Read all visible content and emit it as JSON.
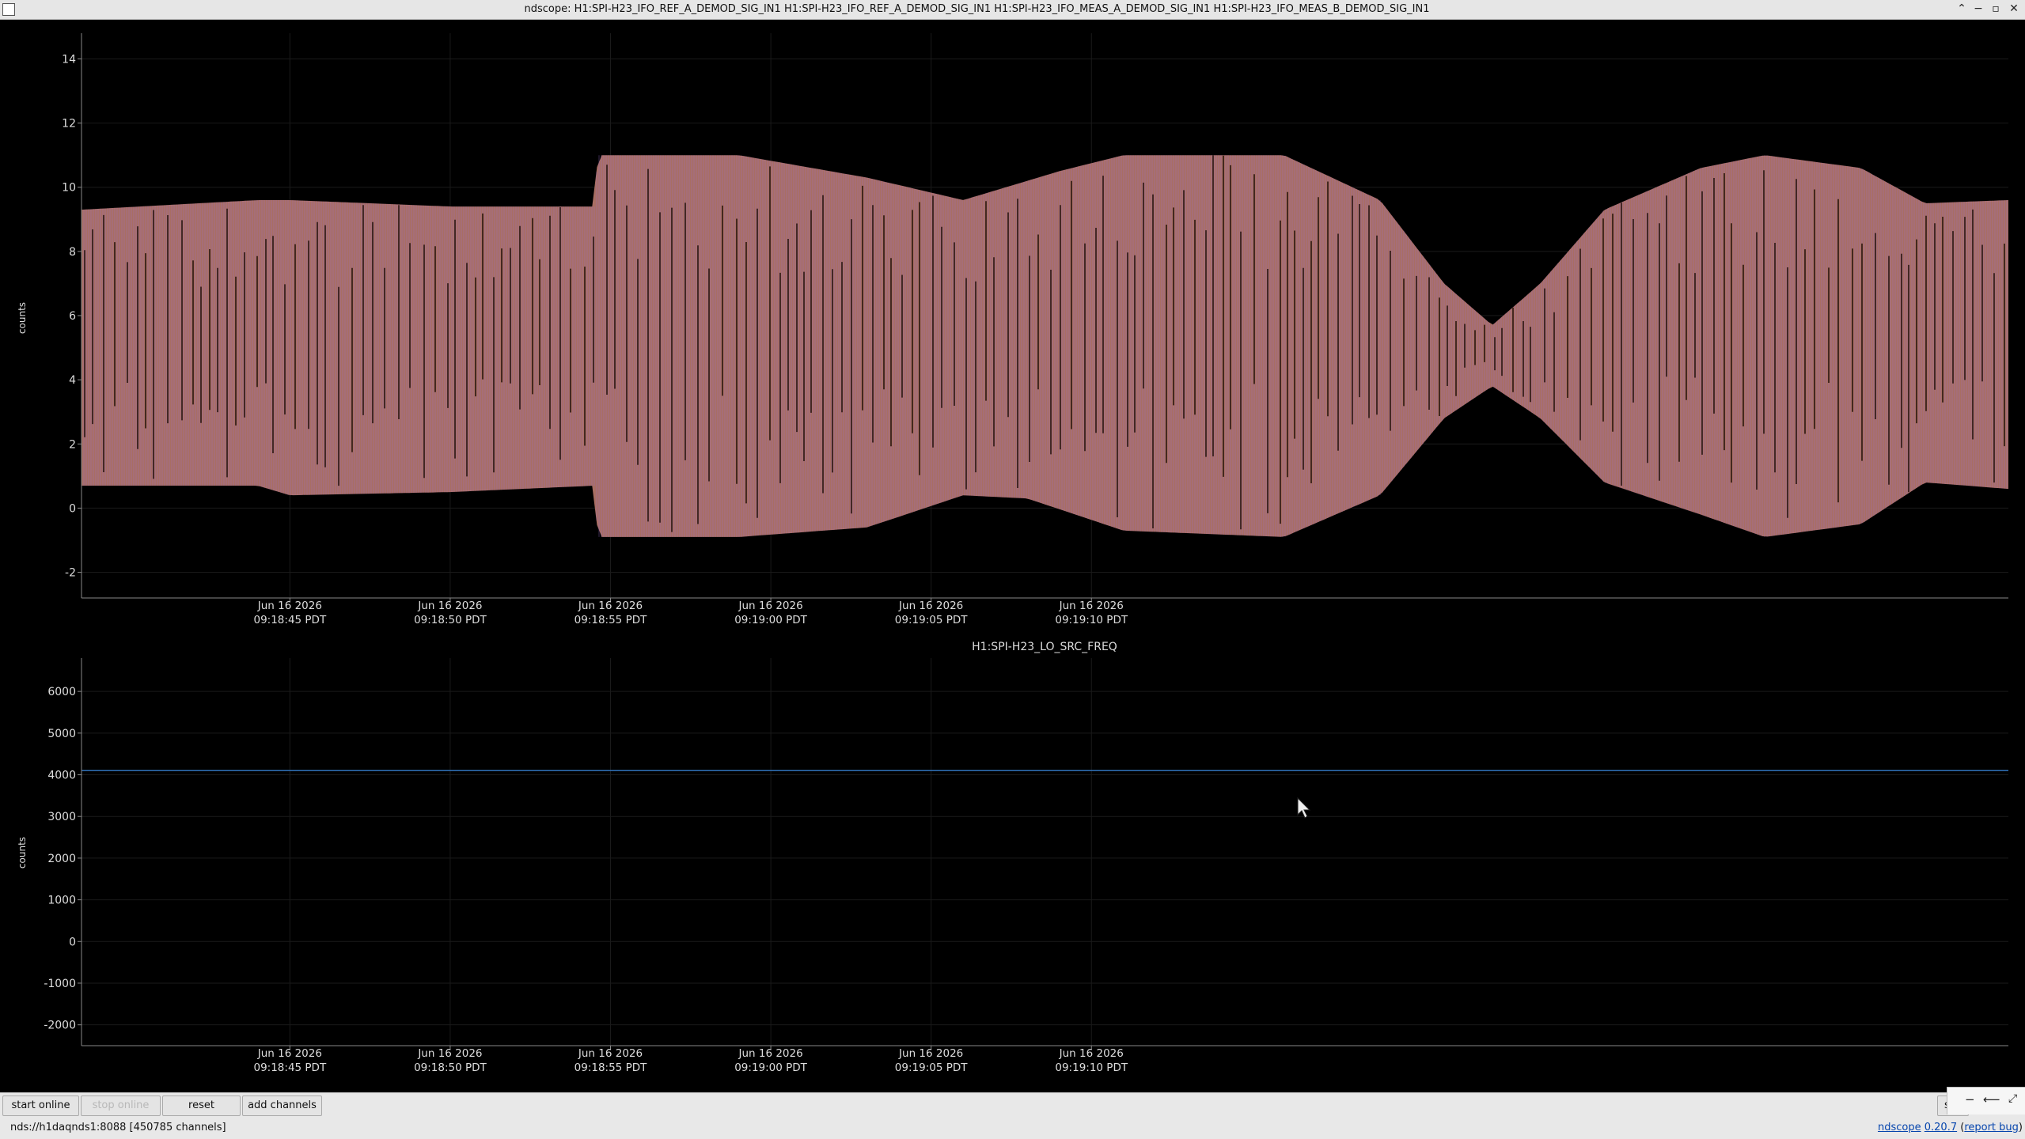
{
  "window": {
    "title": "ndscope: H1:SPI-H23_IFO_REF_A_DEMOD_SIG_IN1 H1:SPI-H23_IFO_REF_A_DEMOD_SIG_IN1 H1:SPI-H23_IFO_MEAS_A_DEMOD_SIG_IN1 H1:SPI-H23_IFO_MEAS_B_DEMOD_SIG_IN1",
    "controls": {
      "minimize": "−",
      "maximize": "▫",
      "close": "✕",
      "menu": "⌃"
    }
  },
  "plots": [
    {
      "ylabel": "counts",
      "title": "",
      "yticks": [
        "14",
        "12",
        "10",
        "8",
        "6",
        "4",
        "2",
        "0",
        "-2"
      ],
      "xticks": [
        {
          "date": "Jun 16 2026",
          "time": "09:18:45 PDT"
        },
        {
          "date": "Jun 16 2026",
          "time": "09:18:50 PDT"
        },
        {
          "date": "Jun 16 2026",
          "time": "09:18:55 PDT"
        },
        {
          "date": "Jun 16 2026",
          "time": "09:19:00 PDT"
        },
        {
          "date": "Jun 16 2026",
          "time": "09:19:05 PDT"
        },
        {
          "date": "Jun 16 2026",
          "time": "09:19:10 PDT"
        }
      ]
    },
    {
      "ylabel": "counts",
      "title": "H1:SPI-H23_LO_SRC_FREQ",
      "yticks": [
        "6000",
        "5000",
        "4000",
        "3000",
        "2000",
        "1000",
        "0",
        "-1000",
        "-2000"
      ],
      "xticks": [
        {
          "date": "Jun 16 2026",
          "time": "09:18:45 PDT"
        },
        {
          "date": "Jun 16 2026",
          "time": "09:18:50 PDT"
        },
        {
          "date": "Jun 16 2026",
          "time": "09:18:55 PDT"
        },
        {
          "date": "Jun 16 2026",
          "time": "09:19:00 PDT"
        },
        {
          "date": "Jun 16 2026",
          "time": "09:19:05 PDT"
        },
        {
          "date": "Jun 16 2026",
          "time": "09:19:10 PDT"
        }
      ]
    }
  ],
  "chart_data": [
    {
      "type": "line",
      "ylabel": "counts",
      "ylim": [
        -2.8,
        14.8
      ],
      "x_unit": "seconds after 09:18:45 PDT",
      "envelope_upper": [
        [
          -6.5,
          9.3
        ],
        [
          -1,
          9.6
        ],
        [
          0,
          9.6
        ],
        [
          5,
          9.4
        ],
        [
          9.5,
          9.4
        ],
        [
          9.6,
          11.0
        ],
        [
          14,
          11.0
        ],
        [
          18,
          10.3
        ],
        [
          21,
          9.6
        ],
        [
          24,
          10.5
        ],
        [
          26,
          11.0
        ],
        [
          31,
          11.0
        ],
        [
          34,
          9.6
        ],
        [
          36,
          7.0
        ],
        [
          37.5,
          5.7
        ],
        [
          39,
          7.0
        ],
        [
          41,
          9.3
        ],
        [
          44,
          10.6
        ],
        [
          46,
          11.0
        ],
        [
          49,
          10.6
        ],
        [
          51,
          9.5
        ],
        [
          53.6,
          9.6
        ]
      ],
      "envelope_lower": [
        [
          -6.5,
          0.7
        ],
        [
          -1,
          0.7
        ],
        [
          0,
          0.4
        ],
        [
          5,
          0.5
        ],
        [
          9.5,
          0.7
        ],
        [
          9.6,
          -0.9
        ],
        [
          14,
          -0.9
        ],
        [
          18,
          -0.6
        ],
        [
          21,
          0.4
        ],
        [
          23,
          0.3
        ],
        [
          26,
          -0.7
        ],
        [
          31,
          -0.9
        ],
        [
          34,
          0.4
        ],
        [
          36,
          2.8
        ],
        [
          37.5,
          3.8
        ],
        [
          39,
          2.8
        ],
        [
          41,
          0.8
        ],
        [
          44,
          -0.2
        ],
        [
          46,
          -0.9
        ],
        [
          49,
          -0.5
        ],
        [
          51,
          0.8
        ],
        [
          53.6,
          0.6
        ]
      ],
      "colors": {
        "fill": "#a86e63",
        "trace": "#9b6fd0",
        "spike": "#2a1710"
      },
      "grid": true
    },
    {
      "type": "line",
      "title": "H1:SPI-H23_LO_SRC_FREQ",
      "ylabel": "counts",
      "ylim": [
        -2500,
        6800
      ],
      "series": [
        {
          "x": [
            -6.5,
            53.6
          ],
          "values": [
            4100,
            4100
          ],
          "color": "#2f6fb5"
        }
      ],
      "grid": true
    }
  ],
  "buttons": {
    "start_online": "start online",
    "stop_online": "stop online",
    "reset": "reset",
    "add_channels": "add channels",
    "hidden_partial": "s"
  },
  "status": "nds://h1daqnds1:8088  [450785 channels]",
  "footer": {
    "app_link": "ndscope",
    "version_link": "0.20.7",
    "report_link": "report bug"
  }
}
